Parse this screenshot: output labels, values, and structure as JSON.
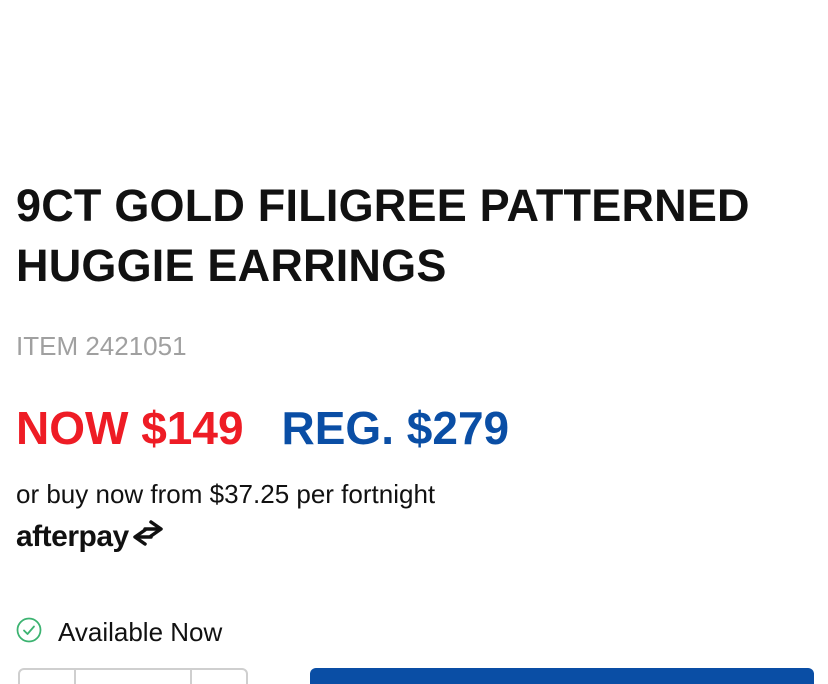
{
  "product": {
    "title": "9CT GOLD FILIGREE PATTERNED HUGGIE EARRINGS",
    "item_label": "ITEM 2421051"
  },
  "pricing": {
    "now": "NOW $149",
    "reg": "REG. $279",
    "now_color": "#ee1c25",
    "reg_color": "#0a4ea5"
  },
  "afterpay": {
    "installment_text": "or buy now from $37.25 per fortnight",
    "logo_text": "afterpay",
    "logo_icon": "afterpay-arrows-icon"
  },
  "availability": {
    "label": "Available Now",
    "icon": "check-circle-icon",
    "icon_color": "#3cb371"
  },
  "cart": {
    "button_color": "#0a4ea5"
  }
}
